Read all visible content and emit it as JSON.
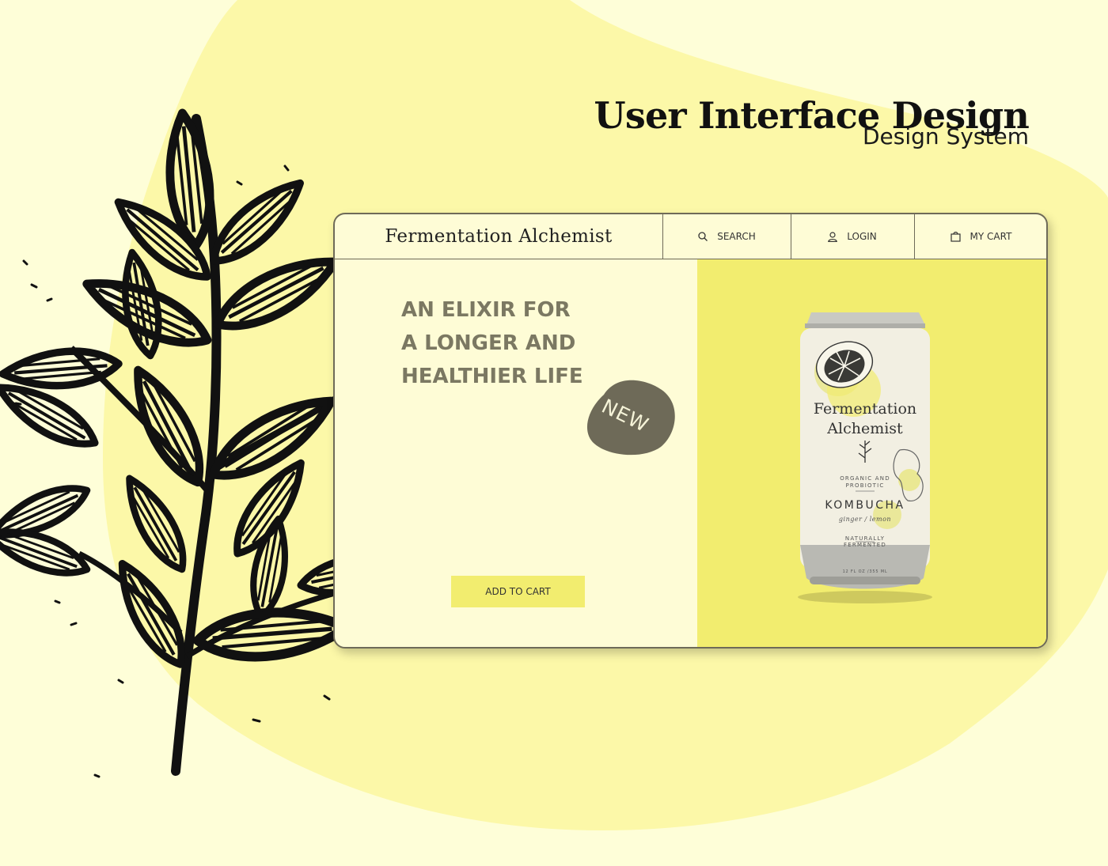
{
  "heading": {
    "title": "User Interface Design",
    "subtitle": "Design System"
  },
  "site": {
    "brand": "Fermentation Alchemist",
    "nav": {
      "search_label": "SEARCH",
      "login_label": "LOGIN",
      "cart_label": "MY CART"
    }
  },
  "hero": {
    "tagline": [
      "AN ELIXIR FOR",
      "A LONGER AND",
      "HEALTHIER LIFE"
    ],
    "badge": "NEW",
    "add_to_cart": "ADD TO CART"
  },
  "product": {
    "brand_line1": "Fermentation",
    "brand_line2": "Alchemist",
    "organic_line1": "ORGANIC AND",
    "organic_line2": "PROBIOTIC",
    "name": "KOMBUCHA",
    "flavor": "ginger / lemon",
    "ferment_line1": "NATURALLY",
    "ferment_line2": "FERMENTED",
    "volume": "12 FL OZ /355 ML"
  },
  "icons": {
    "search": "search-icon",
    "login": "user-icon",
    "cart": "shopping-bag-icon",
    "decor": "leaf-branch-illustration"
  },
  "colors": {
    "background": "#fefed8",
    "blob": "#fcf8a8",
    "panel": "#f2ed6f",
    "text_muted": "#7b7862",
    "badge": "#6e6a58",
    "border": "#6e6a58"
  }
}
